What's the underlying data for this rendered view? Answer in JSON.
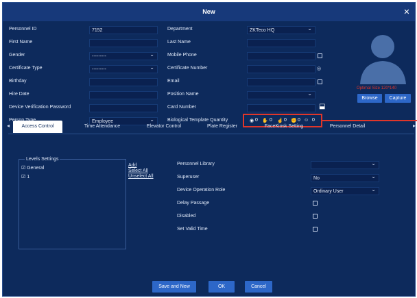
{
  "window": {
    "title": "New"
  },
  "left_fields": [
    {
      "label": "Personnel ID",
      "value": "7152",
      "type": "input"
    },
    {
      "label": "First Name",
      "value": "",
      "type": "input"
    },
    {
      "label": "Gender",
      "value": "---------",
      "type": "select"
    },
    {
      "label": "Certificate Type",
      "value": "---------",
      "type": "select"
    },
    {
      "label": "Birthday",
      "value": "",
      "type": "input"
    },
    {
      "label": "Hire Date",
      "value": "",
      "type": "input"
    },
    {
      "label": "Device Verification Password",
      "value": "",
      "type": "input"
    },
    {
      "label": "Person Type",
      "value": "Employee",
      "type": "select"
    }
  ],
  "right_fields": [
    {
      "label": "Department",
      "value": "ZKTeco HQ",
      "type": "select"
    },
    {
      "label": "Last Name",
      "value": "",
      "type": "input"
    },
    {
      "label": "Mobile Phone",
      "value": "",
      "type": "input"
    },
    {
      "label": "Certificate Number",
      "value": "",
      "type": "input"
    },
    {
      "label": "Email",
      "value": "",
      "type": "input"
    },
    {
      "label": "Position Name",
      "value": "",
      "type": "select"
    },
    {
      "label": "Card Number",
      "value": "",
      "type": "input"
    },
    {
      "label": "Biological Template Quantity",
      "value": "",
      "type": "bio"
    }
  ],
  "bio_counts": [
    "0",
    "0",
    "0",
    "0",
    "0"
  ],
  "photo": {
    "hint": "Optimal Size 120*140",
    "browse": "Browse",
    "capture": "Capture"
  },
  "tabs": [
    "Access Control",
    "Time Attendance",
    "Elevator Control",
    "Plate Register",
    "FaceKiosk Setting",
    "Personnel Detail"
  ],
  "levels": {
    "legend": "Levels Settings",
    "items": [
      "General",
      "1"
    ],
    "add": "Add",
    "select_all": "Select All",
    "unselect_all": "Unselect All"
  },
  "access": [
    {
      "label": "Personnel Library",
      "type": "select",
      "value": ""
    },
    {
      "label": "Superuser",
      "type": "select",
      "value": "No"
    },
    {
      "label": "Device Operation Role",
      "type": "select",
      "value": "Ordinary User"
    },
    {
      "label": "Delay Passage",
      "type": "check",
      "value": ""
    },
    {
      "label": "Disabled",
      "type": "check",
      "value": ""
    },
    {
      "label": "Set Valid Time",
      "type": "check",
      "value": ""
    }
  ],
  "buttons": {
    "save_new": "Save and New",
    "ok": "OK",
    "cancel": "Cancel"
  },
  "colors": {
    "dialog_bg": "#0d2a5c",
    "title_bg": "#17397a",
    "button": "#2d67c8",
    "highlight": "#e0362a",
    "hint": "#e0362a"
  },
  "icons": [
    "close-icon",
    "user-silhouette-icon",
    "fingerprint-icon",
    "palm-icon",
    "finger-vein-icon",
    "hand-icon",
    "face-icon",
    "card-read-icon",
    "chevron-left-icon",
    "chevron-right-icon"
  ]
}
